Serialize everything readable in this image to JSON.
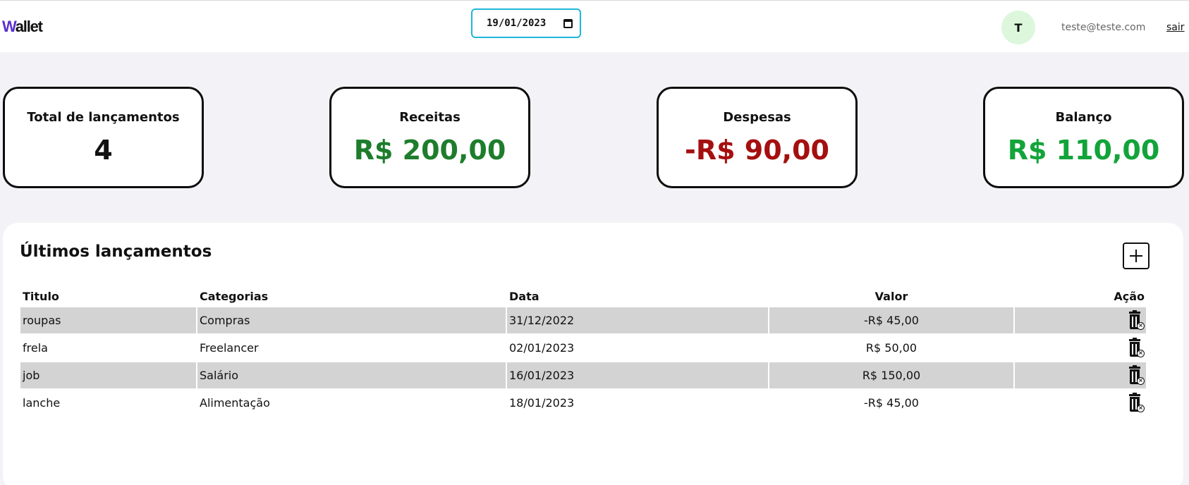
{
  "header": {
    "logo_first": "W",
    "logo_rest": "allet",
    "date_value": "19/01/2023",
    "avatar_initial": "T",
    "user_email": "teste@teste.com",
    "logout_label": "sair"
  },
  "summary": {
    "total_label": "Total de lançamentos",
    "total_value": "4",
    "income_label": "Receitas",
    "income_value": "R$ 200,00",
    "expense_label": "Despesas",
    "expense_value": "-R$ 90,00",
    "balance_label": "Balanço",
    "balance_value": "R$ 110,00"
  },
  "colors": {
    "income": "#1e7d2c",
    "expense": "#a50f0f",
    "balance": "#12a43a",
    "accent": "#1fb6d8",
    "logo_accent": "#5a2fd0"
  },
  "transactions": {
    "title": "Últimos lançamentos",
    "add_icon": "plus-square-icon",
    "delete_icon": "trash-icon",
    "columns": [
      "Titulo",
      "Categorias",
      "Data",
      "Valor",
      "Ação"
    ],
    "rows": [
      {
        "title": "roupas",
        "category": "Compras",
        "date": "31/12/2022",
        "value": "-R$ 45,00"
      },
      {
        "title": "frela",
        "category": "Freelancer",
        "date": "02/01/2023",
        "value": "R$ 50,00"
      },
      {
        "title": "job",
        "category": "Salário",
        "date": "16/01/2023",
        "value": "R$ 150,00"
      },
      {
        "title": "lanche",
        "category": "Alimentação",
        "date": "18/01/2023",
        "value": "-R$ 45,00"
      }
    ]
  }
}
